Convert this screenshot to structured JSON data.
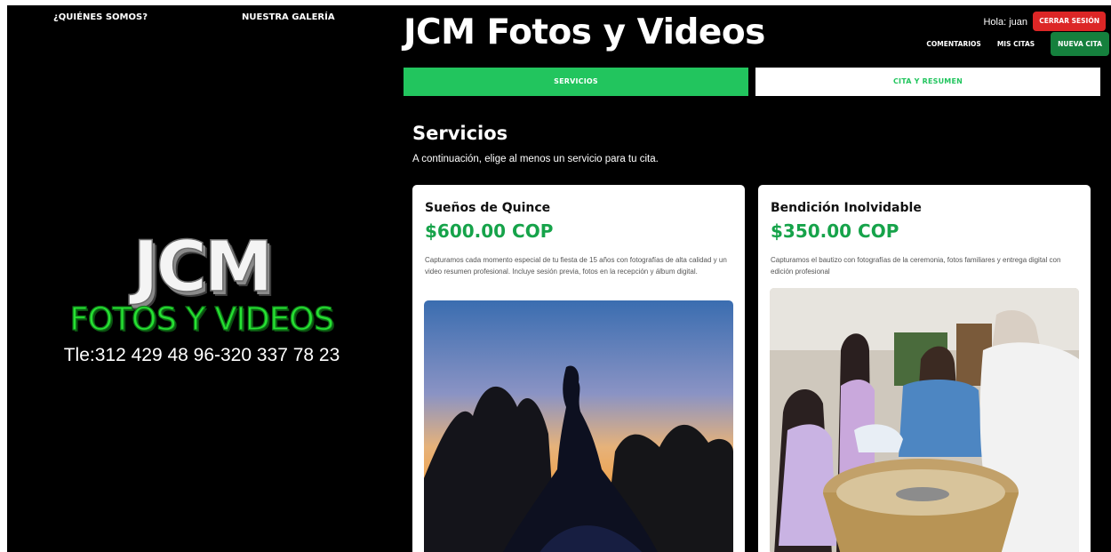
{
  "left_nav": {
    "about_label": "¿QUIÉNES SOMOS?",
    "gallery_label": "NUESTRA GALERÍA"
  },
  "logo": {
    "line1": "JCM",
    "line2": "FOTOS Y VIDEOS",
    "phone": "Tle:312 429 48 96-320 337 78 23"
  },
  "header": {
    "title": "JCM Fotos y Videos",
    "greeting": "Hola: juan",
    "logout_label": "CERRAR SESIÓN",
    "links": {
      "comments": "COMENTARIOS",
      "my_appointments": "MIS CITAS",
      "new_appointment": "NUEVA CITA"
    }
  },
  "tabs": [
    {
      "label": "SERVICIOS",
      "active": true
    },
    {
      "label": "CITA Y RESUMEN",
      "active": false
    }
  ],
  "section": {
    "title": "Servicios",
    "description": "A continuación, elige al menos un servicio para tu cita."
  },
  "services": [
    {
      "name": "Sueños de Quince",
      "price": "$600.00 COP",
      "description": "Capturamos cada momento especial de tu fiesta de 15 años con fotografías de alta calidad y un video resumen profesional. Incluye sesión previa, fotos en la recepción y álbum digital.",
      "image": "quinceanera-silhouette-sunset-photo"
    },
    {
      "name": "Bendición Inolvidable",
      "price": "$350.00 COP",
      "description": "Capturamos el bautizo con fotografías de la ceremonia, fotos familiares y entrega digital con edición profesional",
      "image": "baptism-ceremony-photo"
    }
  ],
  "colors": {
    "background": "#000000",
    "accent_green": "#22c55e",
    "price_green": "#16a34a",
    "logout_red": "#dc2626",
    "new_appointment_green": "#15803d"
  }
}
